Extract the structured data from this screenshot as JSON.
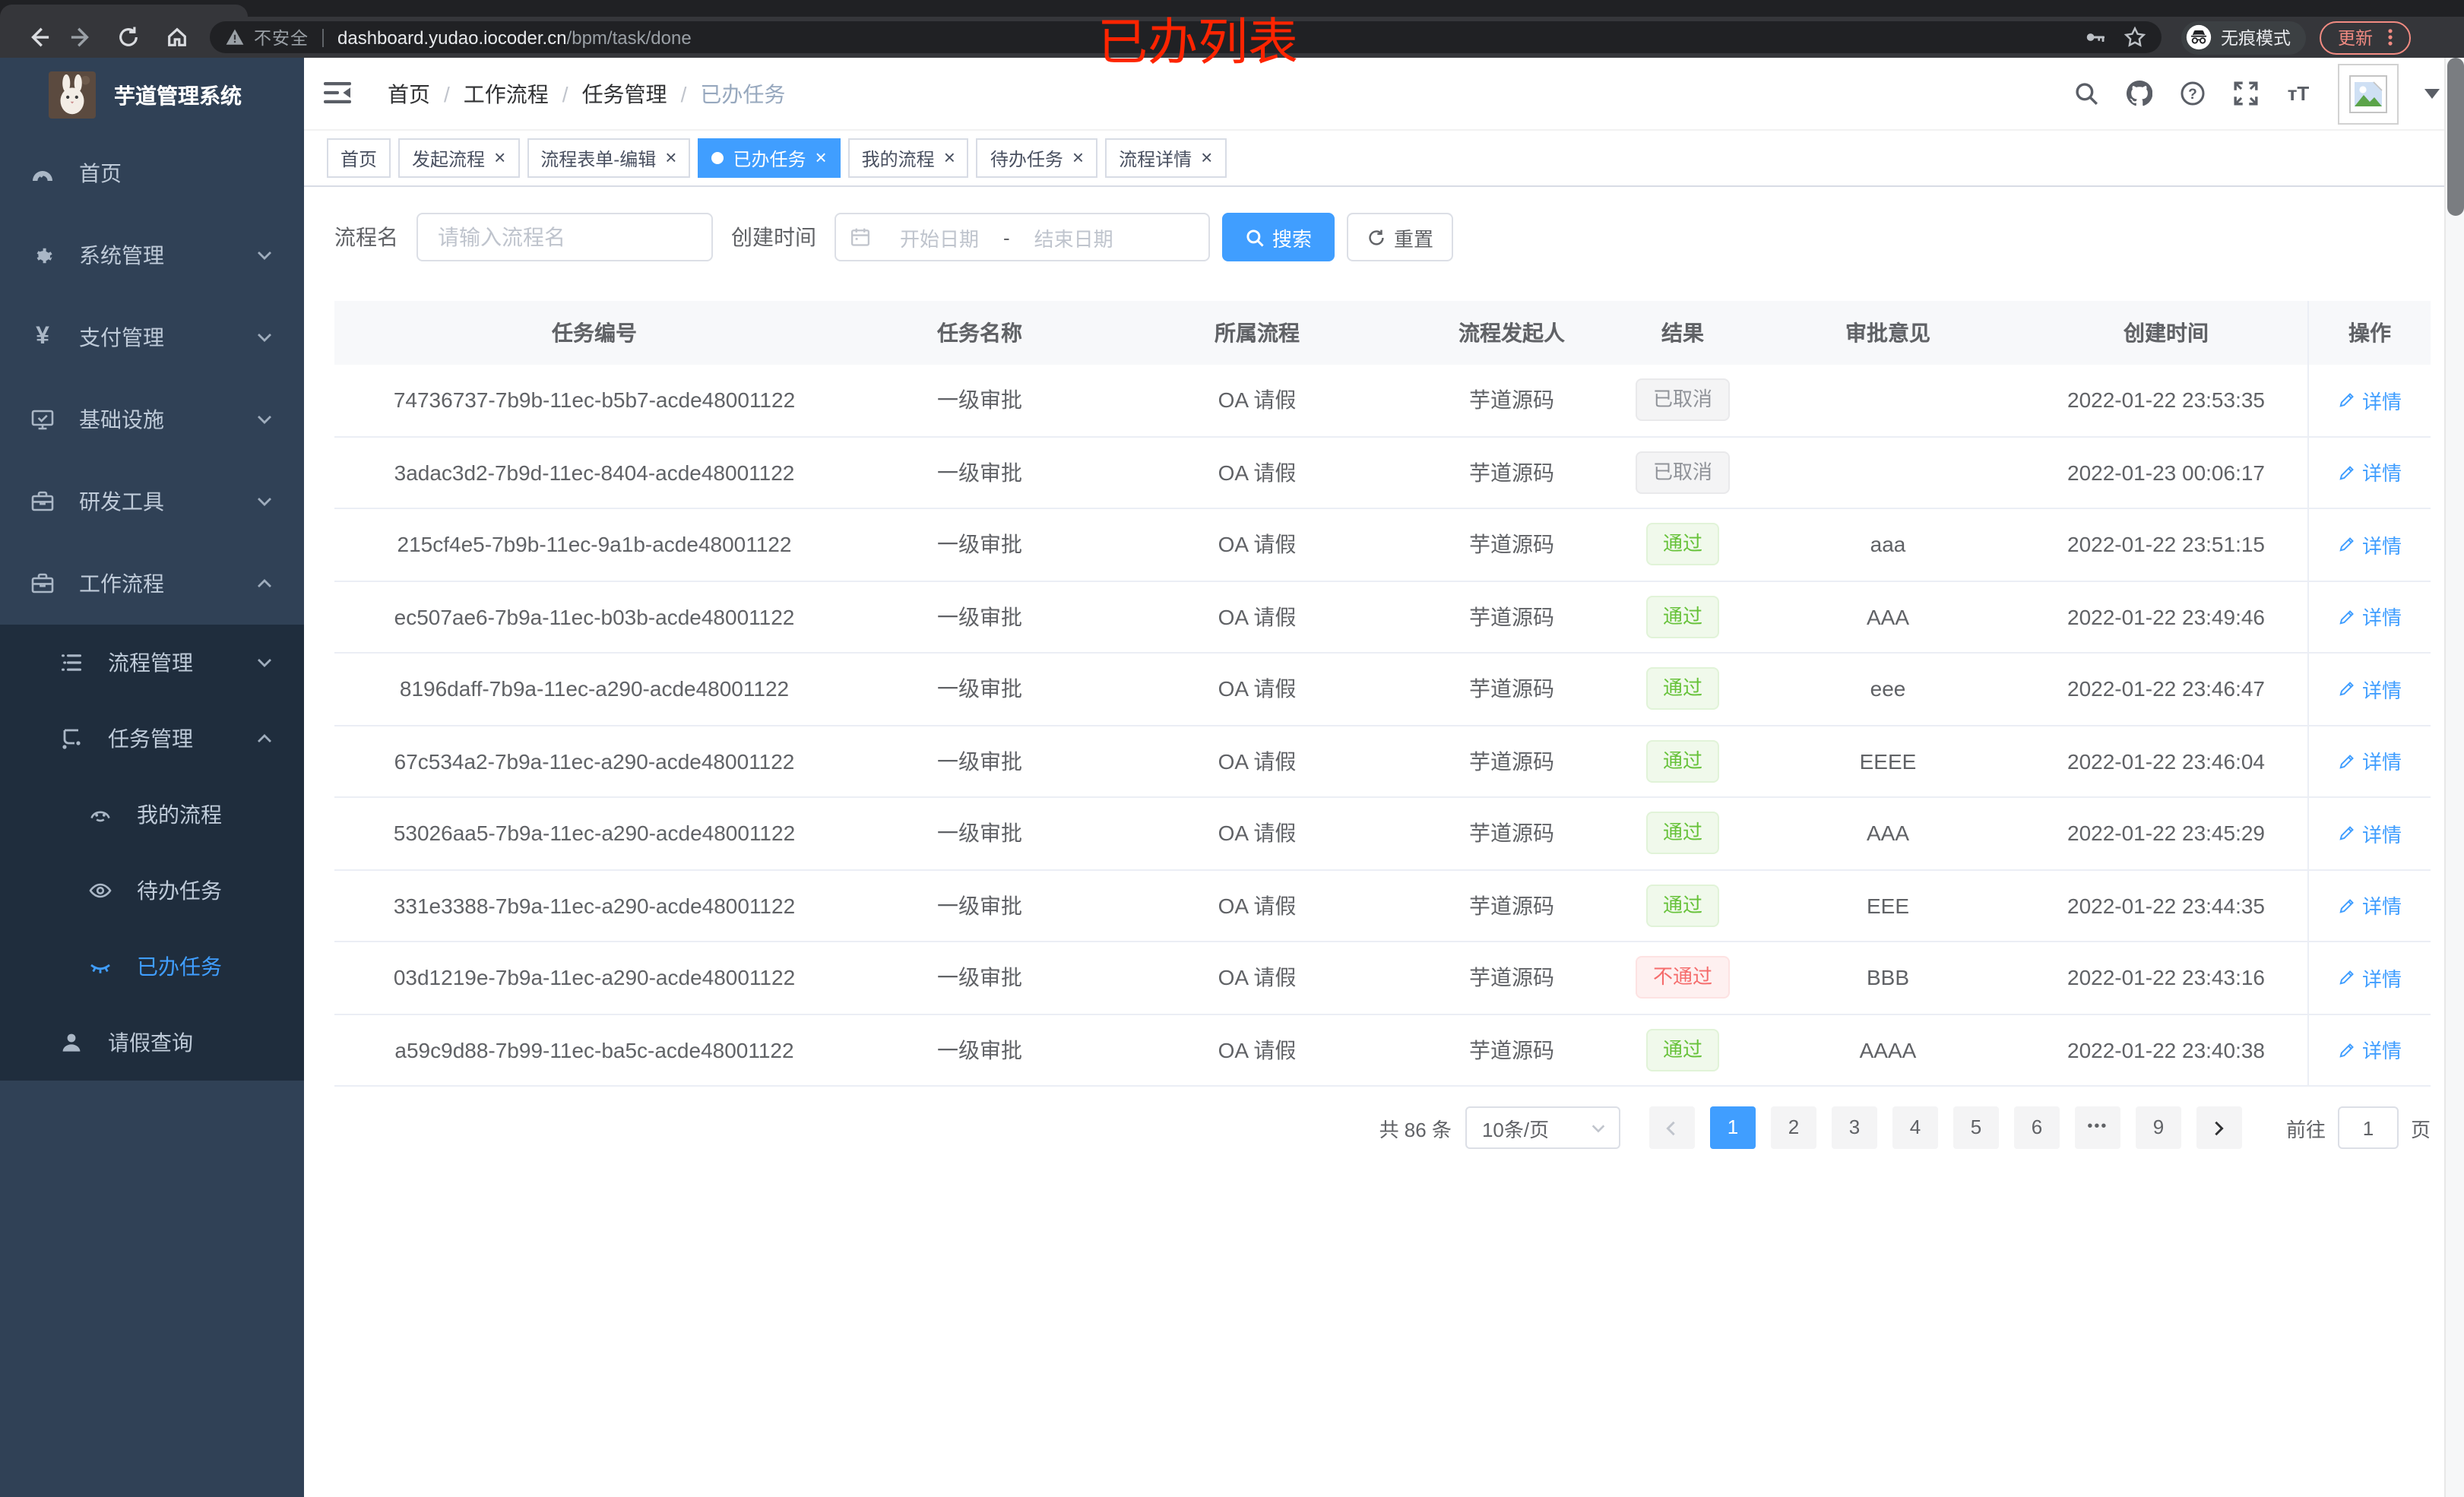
{
  "colors": {
    "accent": "#409eff",
    "sidebar_bg": "#304156",
    "submenu_bg": "#1f2d3d",
    "success_text": "#67c23a",
    "danger_text": "#f56c6c",
    "info_text": "#909399",
    "annotation_red": "#fe2400",
    "update_pill": "#f28b82"
  },
  "browser": {
    "security_label": "不安全",
    "url_host": "dashboard.yudao.iocoder.cn",
    "url_path": "/bpm/task/done",
    "incognito_label": "无痕模式",
    "update_label": "更新",
    "annotation": "已办列表"
  },
  "sidebar": {
    "title": "芋道管理系统",
    "menu": [
      {
        "label": "首页",
        "icon": "dashboard-icon",
        "level": 0,
        "sub": false,
        "arrow": "",
        "active": false
      },
      {
        "label": "系统管理",
        "icon": "gear-icon",
        "level": 0,
        "sub": false,
        "arrow": "down",
        "active": false
      },
      {
        "label": "支付管理",
        "icon": "yen-icon",
        "level": 0,
        "sub": false,
        "arrow": "down",
        "active": false
      },
      {
        "label": "基础设施",
        "icon": "monitor-icon",
        "level": 0,
        "sub": false,
        "arrow": "down",
        "active": false
      },
      {
        "label": "研发工具",
        "icon": "toolbox-icon",
        "level": 0,
        "sub": false,
        "arrow": "down",
        "active": false
      },
      {
        "label": "工作流程",
        "icon": "briefcase-icon",
        "level": 0,
        "sub": false,
        "arrow": "up",
        "active": false
      },
      {
        "label": "流程管理",
        "icon": "list-icon",
        "level": 1,
        "sub": true,
        "arrow": "down",
        "active": false
      },
      {
        "label": "任务管理",
        "icon": "tree-icon",
        "level": 1,
        "sub": true,
        "arrow": "up",
        "active": false
      },
      {
        "label": "我的流程",
        "icon": "face-icon",
        "level": 2,
        "sub": true,
        "arrow": "",
        "active": false
      },
      {
        "label": "待办任务",
        "icon": "eye-icon",
        "level": 2,
        "sub": true,
        "arrow": "",
        "active": false
      },
      {
        "label": "已办任务",
        "icon": "eye-closed-icon",
        "level": 2,
        "sub": true,
        "arrow": "",
        "active": true
      },
      {
        "label": "请假查询",
        "icon": "user-icon",
        "level": 1,
        "sub": true,
        "arrow": "",
        "active": false
      }
    ]
  },
  "header": {
    "breadcrumb": [
      "首页",
      "工作流程",
      "任务管理",
      "已办任务"
    ]
  },
  "tabs": [
    {
      "label": "首页",
      "closable": false,
      "active": false
    },
    {
      "label": "发起流程",
      "closable": true,
      "active": false
    },
    {
      "label": "流程表单-编辑",
      "closable": true,
      "active": false
    },
    {
      "label": "已办任务",
      "closable": true,
      "active": true
    },
    {
      "label": "我的流程",
      "closable": true,
      "active": false
    },
    {
      "label": "待办任务",
      "closable": true,
      "active": false
    },
    {
      "label": "流程详情",
      "closable": true,
      "active": false
    }
  ],
  "filters": {
    "name_label": "流程名",
    "name_placeholder": "请输入流程名",
    "time_label": "创建时间",
    "start_placeholder": "开始日期",
    "range_separator": "-",
    "end_placeholder": "结束日期",
    "search_label": "搜索",
    "reset_label": "重置"
  },
  "table": {
    "columns": [
      "任务编号",
      "任务名称",
      "所属流程",
      "流程发起人",
      "结果",
      "审批意见",
      "创建时间",
      "操作"
    ],
    "action_label": "详情",
    "rows": [
      {
        "id": "74736737-7b9b-11ec-b5b7-acde48001122",
        "name": "一级审批",
        "flow": "OA 请假",
        "starter": "芋道源码",
        "result": "已取消",
        "result_type": "info",
        "comment": "",
        "time": "2022-01-22 23:53:35"
      },
      {
        "id": "3adac3d2-7b9d-11ec-8404-acde48001122",
        "name": "一级审批",
        "flow": "OA 请假",
        "starter": "芋道源码",
        "result": "已取消",
        "result_type": "info",
        "comment": "",
        "time": "2022-01-23 00:06:17"
      },
      {
        "id": "215cf4e5-7b9b-11ec-9a1b-acde48001122",
        "name": "一级审批",
        "flow": "OA 请假",
        "starter": "芋道源码",
        "result": "通过",
        "result_type": "success",
        "comment": "aaa",
        "time": "2022-01-22 23:51:15"
      },
      {
        "id": "ec507ae6-7b9a-11ec-b03b-acde48001122",
        "name": "一级审批",
        "flow": "OA 请假",
        "starter": "芋道源码",
        "result": "通过",
        "result_type": "success",
        "comment": "AAA",
        "time": "2022-01-22 23:49:46"
      },
      {
        "id": "8196daff-7b9a-11ec-a290-acde48001122",
        "name": "一级审批",
        "flow": "OA 请假",
        "starter": "芋道源码",
        "result": "通过",
        "result_type": "success",
        "comment": "eee",
        "time": "2022-01-22 23:46:47"
      },
      {
        "id": "67c534a2-7b9a-11ec-a290-acde48001122",
        "name": "一级审批",
        "flow": "OA 请假",
        "starter": "芋道源码",
        "result": "通过",
        "result_type": "success",
        "comment": "EEEE",
        "time": "2022-01-22 23:46:04"
      },
      {
        "id": "53026aa5-7b9a-11ec-a290-acde48001122",
        "name": "一级审批",
        "flow": "OA 请假",
        "starter": "芋道源码",
        "result": "通过",
        "result_type": "success",
        "comment": "AAA",
        "time": "2022-01-22 23:45:29"
      },
      {
        "id": "331e3388-7b9a-11ec-a290-acde48001122",
        "name": "一级审批",
        "flow": "OA 请假",
        "starter": "芋道源码",
        "result": "通过",
        "result_type": "success",
        "comment": "EEE",
        "time": "2022-01-22 23:44:35"
      },
      {
        "id": "03d1219e-7b9a-11ec-a290-acde48001122",
        "name": "一级审批",
        "flow": "OA 请假",
        "starter": "芋道源码",
        "result": "不通过",
        "result_type": "danger",
        "comment": "BBB",
        "time": "2022-01-22 23:43:16"
      },
      {
        "id": "a59c9d88-7b99-11ec-ba5c-acde48001122",
        "name": "一级审批",
        "flow": "OA 请假",
        "starter": "芋道源码",
        "result": "通过",
        "result_type": "success",
        "comment": "AAAA",
        "time": "2022-01-22 23:40:38"
      }
    ]
  },
  "pagination": {
    "total_label": "共 86 条",
    "page_size": "10条/页",
    "pages": [
      "1",
      "2",
      "3",
      "4",
      "5",
      "6",
      "•••",
      "9"
    ],
    "active_page": "1",
    "goto_label": "前往",
    "goto_value": "1",
    "unit_label": "页"
  }
}
